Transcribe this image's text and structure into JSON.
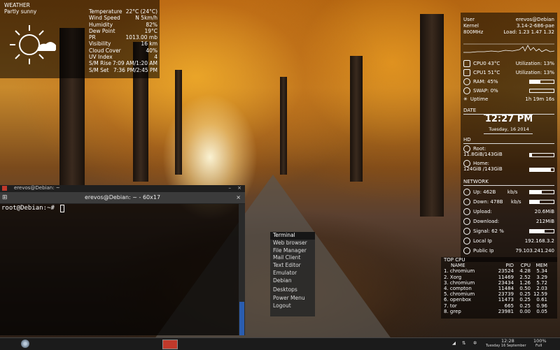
{
  "weather": {
    "header": "WEATHER",
    "condition": "Partly sunny",
    "rows": [
      {
        "label": "Temperature",
        "value": "22°C (24°C)"
      },
      {
        "label": "Wind Speed",
        "value": "N 5km/h"
      },
      {
        "label": "Humidity",
        "value": "82%"
      },
      {
        "label": "Dew Point",
        "value": "19°C"
      },
      {
        "label": "PR",
        "value": "1013.00 mb"
      },
      {
        "label": "Visibility",
        "value": "16 km"
      },
      {
        "label": "Cloud Cover",
        "value": "40%"
      },
      {
        "label": "UV Index",
        "value": "4"
      },
      {
        "label": "S/M Rise",
        "value": "7:09 AM/1:20 AM"
      },
      {
        "label": "S/M Set",
        "value": "7:36 PM/2:45 PM"
      }
    ]
  },
  "system": {
    "user_label": "User",
    "user_value": "erevos@Debian",
    "kernel_label": "Kernel",
    "kernel_value": "3.14-2-686-pae",
    "freq": "800MHz",
    "load": "Load: 1.23 1.47 1.32",
    "cpu0": "CPU0 43°C",
    "cpu0_util": "Utilization: 13%",
    "cpu1": "CPU1 51°C",
    "cpu1_util": "Utilization: 13%",
    "ram": "RAM: 45%",
    "ram_fill": 0.45,
    "swap": "SWAP: 0%",
    "swap_fill": 0.0,
    "uptime_label": "Uptime",
    "uptime_value": "1h 19m 16s"
  },
  "date": {
    "header": "DATE",
    "time": "12:27 PM",
    "day": "Tuesday, 16 2014"
  },
  "hd": {
    "header": "HD",
    "root_label": "Root:",
    "root_value": "11.8GiB/143GiB",
    "root_fill": 0.08,
    "home_label": "Home:",
    "home_value": "124GiB /143GiB",
    "home_fill": 0.87
  },
  "network": {
    "header": "NETWORK",
    "up": "Up: 462B",
    "up_unit": "kb/s",
    "down": "Down: 478B",
    "down_unit": "kb/s",
    "upload_label": "Upload:",
    "upload_value": "20.6MiB",
    "download_label": "Download:",
    "download_value": "212MiB",
    "signal": "Signal: 62 %",
    "signal_fill": 0.62,
    "local_label": "Local Ip",
    "local_value": "192.168.3.2",
    "public_label": "Public Ip",
    "public_value": "79.103.241.240"
  },
  "top_cpu": {
    "header": "TOP CPU",
    "columns": [
      "NAME",
      "PID",
      "CPU",
      "MEM"
    ],
    "rows": [
      [
        "1. chromium",
        "23524",
        "4.28",
        "5.34"
      ],
      [
        "2. Xorg",
        "11469",
        "2.52",
        "3.29"
      ],
      [
        "3. chromium",
        "23434",
        "1.26",
        "5.72"
      ],
      [
        "4. compton",
        "11484",
        "0.50",
        "2.03"
      ],
      [
        "5. chromium",
        "23739",
        "0.25",
        "12.59"
      ],
      [
        "6. openbox",
        "11473",
        "0.25",
        "0.61"
      ],
      [
        "7. tor",
        "665",
        "0.25",
        "0.96"
      ],
      [
        "8. grep",
        "23981",
        "0.00",
        "0.05"
      ]
    ]
  },
  "terminal": {
    "window_title": "erevos@Debian: ~",
    "tab_title": "erevos@Debian: ~ - 60x17",
    "prompt": "root@Debian:~# "
  },
  "menu": {
    "items": [
      "Terminal",
      "Web browser",
      "File Manager",
      "Mail Client",
      "Text Editor",
      "Emulator",
      "Debian",
      "Desktops",
      "Power Menu",
      "Logout"
    ]
  },
  "taskbar": {
    "clock_time": "12:28",
    "clock_date": "Tuesday 16 September",
    "battery_percent": "100%",
    "battery_status": "Full"
  }
}
